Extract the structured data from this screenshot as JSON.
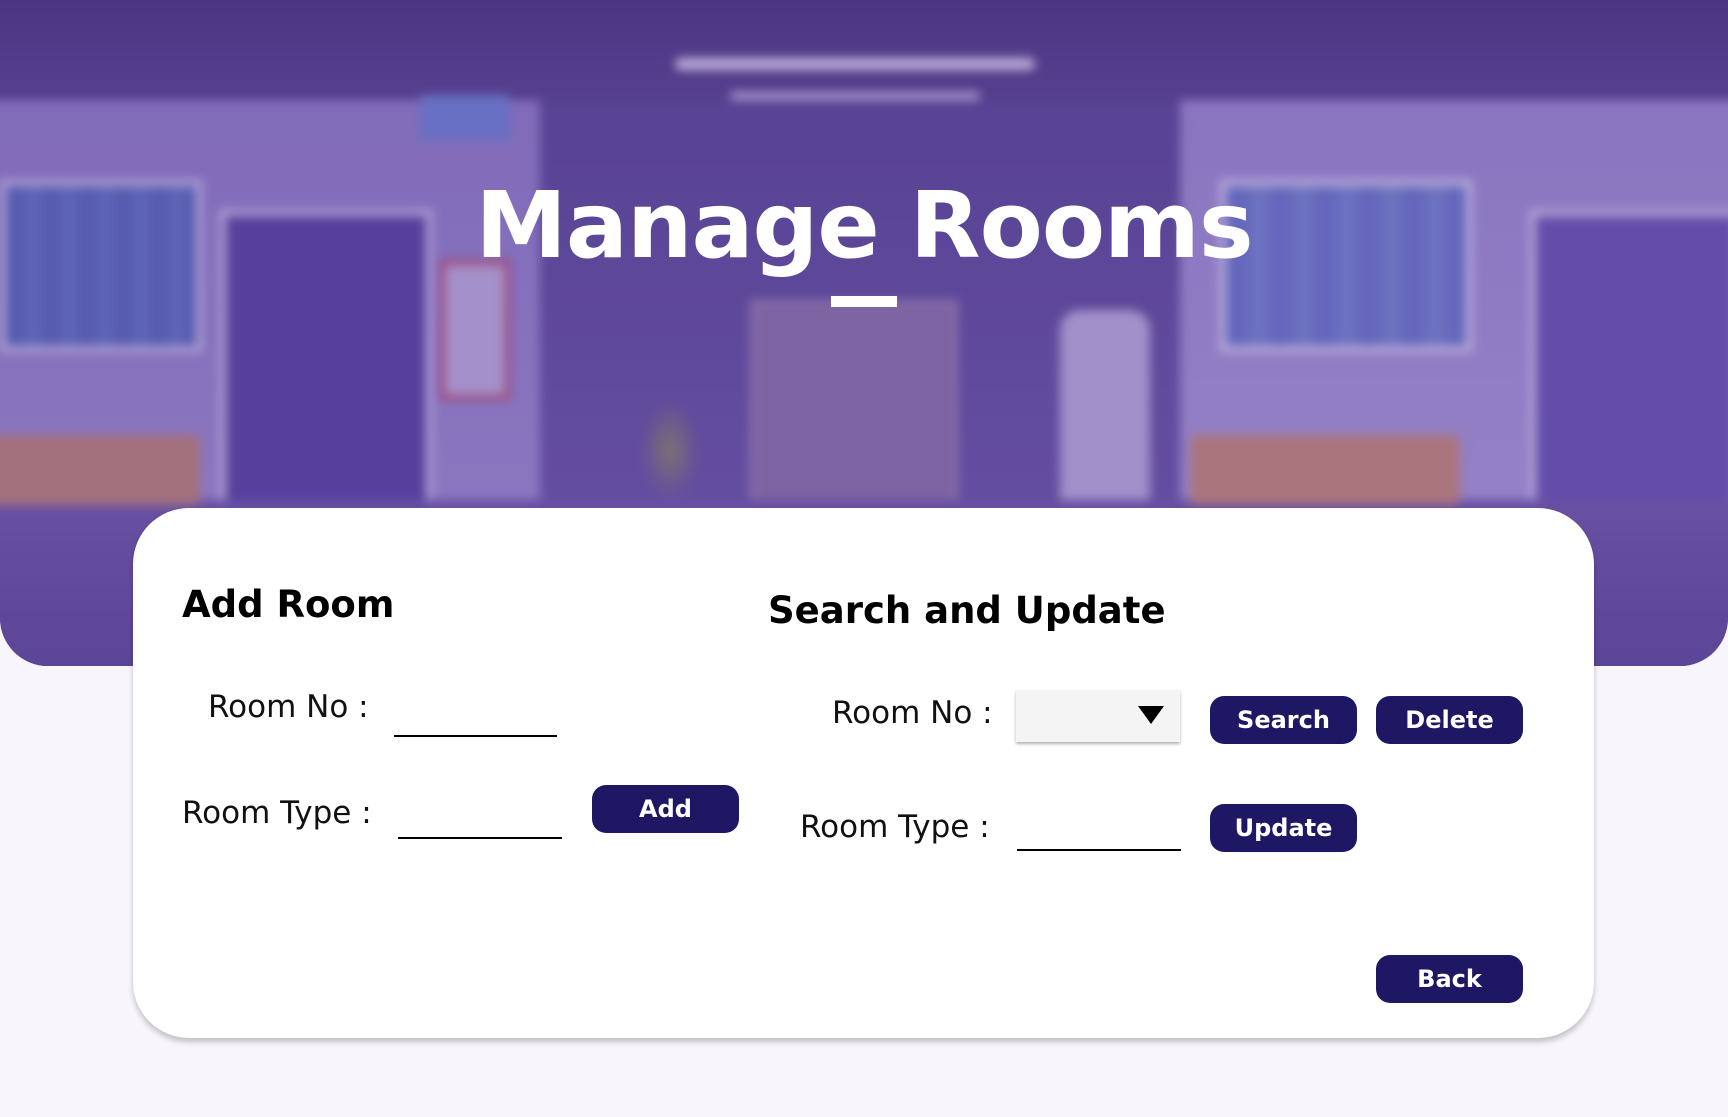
{
  "header": {
    "title": "Manage Rooms"
  },
  "add_room": {
    "title": "Add Room",
    "room_no_label": "Room No :",
    "room_no_value": "",
    "room_type_label": "Room Type :",
    "room_type_value": "",
    "add_button": "Add"
  },
  "search_update": {
    "title": "Search and Update",
    "room_no_label": "Room No :",
    "room_no_selected": "",
    "room_type_label": "Room Type :",
    "room_type_value": "",
    "search_button": "Search",
    "delete_button": "Delete",
    "update_button": "Update"
  },
  "footer": {
    "back_button": "Back"
  },
  "colors": {
    "button_bg": "#1e1864",
    "button_text": "#ffffff",
    "hero_tint": "#6a53a4",
    "card_bg": "#ffffff",
    "page_bg": "#f8f6fc"
  },
  "icons": {
    "dropdown": "caret-down-icon"
  }
}
